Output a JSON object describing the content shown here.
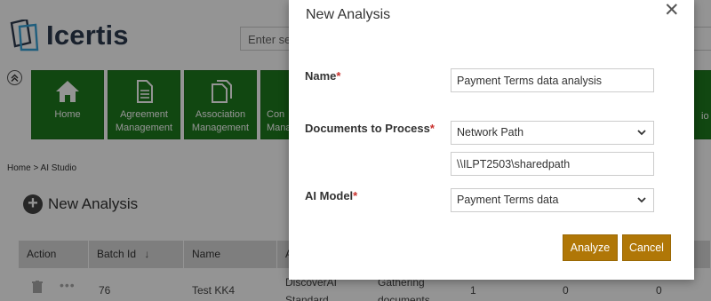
{
  "app": {
    "logo_text": "Icertis",
    "search_placeholder": "Enter se",
    "collapse_icon": "double-chevron-up-icon",
    "tiles": [
      {
        "label_line1": "Home",
        "label_line2": "",
        "icon": "home-icon"
      },
      {
        "label_line1": "Agreement",
        "label_line2": "Management",
        "icon": "document-icon"
      },
      {
        "label_line1": "Association",
        "label_line2": "Management",
        "icon": "copy-icon"
      },
      {
        "label_line1": "Con",
        "label_line2": "Mana",
        "icon": "document-icon"
      },
      {
        "label_line1": "io",
        "label_line2": "",
        "icon": ""
      }
    ],
    "breadcrumb": "Home > AI Studio",
    "heading": "New Analysis",
    "table": {
      "columns": [
        "Action",
        "Batch Id",
        "Name",
        "A",
        ""
      ],
      "batch_sort_icon": "↓",
      "rows": [
        {
          "batch_id": "76",
          "name": "Test KK4",
          "col4_line1": "DiscoverAI",
          "col4_line2": "Standard",
          "status_line1": "Gathering",
          "status_line2": "documents",
          "n1": "1",
          "n2": "0",
          "n3": "0"
        }
      ]
    }
  },
  "modal": {
    "title": "New Analysis",
    "close_icon": "close-icon",
    "name": {
      "label": "Name",
      "required": "*",
      "value": "Payment Terms data analysis"
    },
    "documents": {
      "label": "Documents to Process",
      "required": "*",
      "selected": "Network Path",
      "path_value": "\\\\ILPT2503\\sharedpath"
    },
    "ai_model": {
      "label": "AI Model",
      "required": "*",
      "selected": "Payment Terms data"
    },
    "buttons": {
      "analyze": "Analyze",
      "cancel": "Cancel"
    }
  },
  "colors": {
    "tile_green": "#1e7a1e",
    "button_gold": "#b07707",
    "required_red": "#c9302c",
    "overlay": "rgba(0,0,0,0.42)"
  }
}
